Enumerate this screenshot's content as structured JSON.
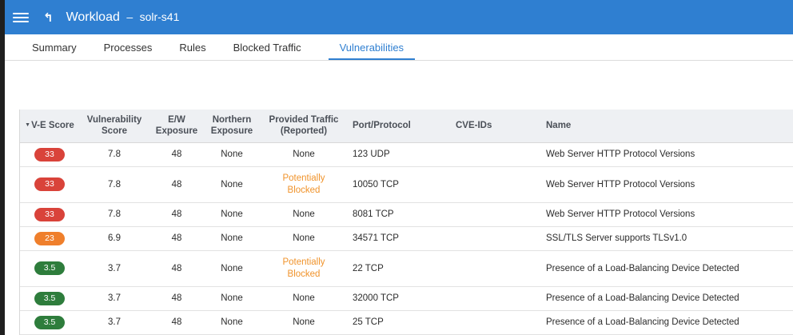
{
  "header": {
    "title": "Workload",
    "separator": "–",
    "subtitle": "solr-s41"
  },
  "tabs": [
    {
      "label": "Summary"
    },
    {
      "label": "Processes"
    },
    {
      "label": "Rules"
    },
    {
      "label": "Blocked Traffic"
    },
    {
      "label": "Vulnerabilities"
    }
  ],
  "table": {
    "columns": [
      {
        "line1": "V-E Score",
        "line2": ""
      },
      {
        "line1": "Vulnerability",
        "line2": "Score"
      },
      {
        "line1": "E/W",
        "line2": "Exposure"
      },
      {
        "line1": "Northern",
        "line2": "Exposure"
      },
      {
        "line1": "Provided Traffic",
        "line2": "(Reported)"
      },
      {
        "line1": "Port/Protocol",
        "line2": ""
      },
      {
        "line1": "CVE-IDs",
        "line2": ""
      },
      {
        "line1": "Name",
        "line2": ""
      }
    ],
    "rows": [
      {
        "ve": "33",
        "color": "#d9433a",
        "vuln": "7.8",
        "ew": "48",
        "north": "None",
        "traffic1": "None",
        "traffic2": "",
        "port": "123 UDP",
        "cve": "",
        "name": "Web Server HTTP Protocol Versions"
      },
      {
        "ve": "33",
        "color": "#d9433a",
        "vuln": "7.8",
        "ew": "48",
        "north": "None",
        "traffic1": "Potentially",
        "traffic2": "Blocked",
        "port": "10050 TCP",
        "cve": "",
        "name": "Web Server HTTP Protocol Versions"
      },
      {
        "ve": "33",
        "color": "#d9433a",
        "vuln": "7.8",
        "ew": "48",
        "north": "None",
        "traffic1": "None",
        "traffic2": "",
        "port": "8081 TCP",
        "cve": "",
        "name": "Web Server HTTP Protocol Versions"
      },
      {
        "ve": "23",
        "color": "#ef7f2c",
        "vuln": "6.9",
        "ew": "48",
        "north": "None",
        "traffic1": "None",
        "traffic2": "",
        "port": "34571 TCP",
        "cve": "",
        "name": "SSL/TLS Server supports TLSv1.0"
      },
      {
        "ve": "3.5",
        "color": "#2e7d3c",
        "vuln": "3.7",
        "ew": "48",
        "north": "None",
        "traffic1": "Potentially",
        "traffic2": "Blocked",
        "port": "22 TCP",
        "cve": "",
        "name": "Presence of a Load-Balancing Device Detected"
      },
      {
        "ve": "3.5",
        "color": "#2e7d3c",
        "vuln": "3.7",
        "ew": "48",
        "north": "None",
        "traffic1": "None",
        "traffic2": "",
        "port": "32000 TCP",
        "cve": "",
        "name": "Presence of a Load-Balancing Device Detected"
      },
      {
        "ve": "3.5",
        "color": "#2e7d3c",
        "vuln": "3.7",
        "ew": "48",
        "north": "None",
        "traffic1": "None",
        "traffic2": "",
        "port": "25 TCP",
        "cve": "",
        "name": "Presence of a Load-Balancing Device Detected"
      }
    ]
  },
  "icons": {
    "menu": "hamburger-menu-icon",
    "up": "up-arrow-icon",
    "sort": "sort-desc-icon"
  }
}
